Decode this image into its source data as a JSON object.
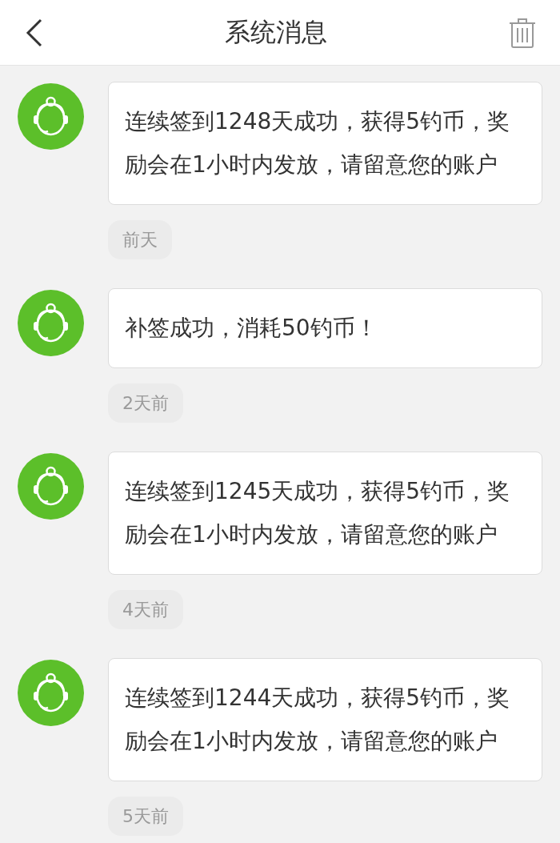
{
  "header": {
    "title": "系统消息"
  },
  "messages": [
    {
      "text": "连续签到1248天成功，获得5钓币，奖励会在1小时内发放，请留意您的账户",
      "time": "前天"
    },
    {
      "text": "补签成功，消耗50钓币！",
      "time": "2天前"
    },
    {
      "text": "连续签到1245天成功，获得5钓币，奖励会在1小时内发放，请留意您的账户",
      "time": "4天前"
    },
    {
      "text": "连续签到1244天成功，获得5钓币，奖励会在1小时内发放，请留意您的账户",
      "time": "5天前"
    }
  ]
}
